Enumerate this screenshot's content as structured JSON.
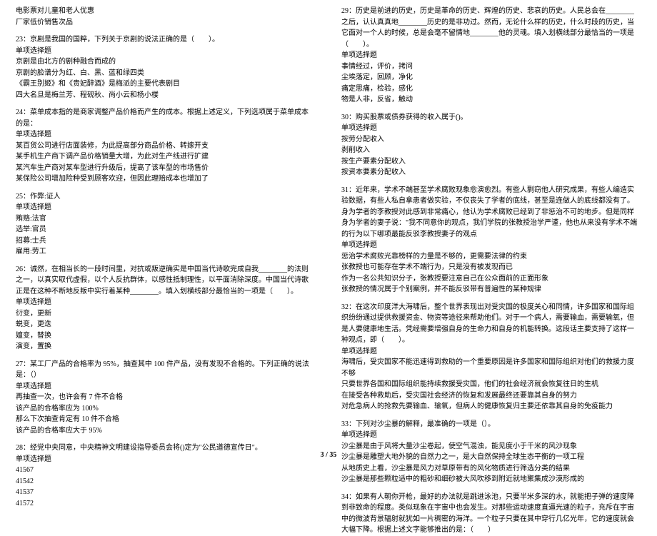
{
  "left": {
    "preamble": [
      "电影票对儿童和老人优惠",
      "厂家低价销售次品"
    ],
    "q23": {
      "stem": "23：京剧是我国的国粹，下列关于京剧的说法正确的是（　　）。",
      "type": "单项选择题",
      "opts": [
        "京剧是由北方的剧种融合而成的",
        "京剧的脸谱分为红、白、黑、蓝和绿四类",
        "《霸王别姬》和《贵妃醉酒》是梅派的主要代表剧目",
        "四大名旦是梅兰芳、程砚秋、尚小云和杨小楼"
      ]
    },
    "q24": {
      "stem": "24：菜单成本指的是商家调整产品价格而产生的成本。根据上述定义，下列选项属于菜单成本的是：",
      "type": "单项选择题",
      "opts": [
        "某百货公司进行店面装修，为此提高部分商品价格、转嫁开支",
        "某手机生产商下调产品价格销量大增，为此对生产线进行扩建",
        "某汽车生产商对某车型进行升级后，提高了该车型的市场售价",
        "某保险公司增加险种受到顾客欢迎，但因此理赔成本也增加了"
      ]
    },
    "q25": {
      "stem": "25：作弊:证人",
      "type": "单项选择题",
      "opts": [
        "贿赂:法官",
        "选举:官员",
        "招募:士兵",
        "雇用:劳工"
      ]
    },
    "q26": {
      "stem": "26：诚然，在相当长的一段时间里，对抗或叛逆确实是中国当代诗歌完成自我________的法则之一，以真实取代虚假，以个人反抗群体，以感性抵制理性，以平面消除深度。中国当代诗歌正是在这种不断地反叛中实行着某种________。填入划横线部分最恰当的一项是（　　）。",
      "type": "单项选择题",
      "opts": [
        "衍变，更新",
        "蜕变，更迭",
        "嬗变，替换",
        "演变，置换"
      ]
    },
    "q27": {
      "stem": "27：某工厂产品的合格率为 95%，抽查其中 100 件产品，没有发现不合格的。下列正确的说法是：（）",
      "type": "单项选择题",
      "opts": [
        "再抽查一次，也许会有 7 件不合格",
        "该产品的合格率应为 100%",
        "那么下次抽查肯定有 10 件不合格",
        "该产品的合格率应大于 95%"
      ]
    },
    "q28": {
      "stem": "28：经党中央同意，中央精神文明建设指导委员会将()定为\"公民道德宣传日\"。",
      "type": "单项选择题",
      "opts": [
        "41567",
        "41542",
        "41537",
        "41572"
      ]
    }
  },
  "right": {
    "q29": {
      "stem": "29：历史是前进的历史，历史是革命的历史、辉煌的历史、悲哀的历史。人民总会在________之后，认认真真地________历史的是非功过。然而，无论什么样的历史，什么时段的历史，当它面对一个人的时候，总是会毫不留情地________他的灵魂。填入划横线部分最恰当的一项是（　　）。",
      "type": "单项选择题",
      "opts": [
        "事情经过，评价，拷问",
        "尘埃落定，回顾，净化",
        "痛定思痛，检验，感化",
        "物是人非，反省，触动"
      ]
    },
    "q30": {
      "stem": "30：购买股票或债券获得的收入属于()。 ",
      "type": "单项选择题",
      "opts": [
        "按劳分配收入",
        "剥削收入",
        "按生产要素分配收入",
        "按资本要素分配收入"
      ]
    },
    "q31": {
      "stem": "31：近年来，学术不端甚至学术腐败现象愈演愈烈。有些人剽窃他人研究成果，有些人编造实验数据，有些人私自拿患者做实验，不仅丧失了学者的底线，甚至是连做人的底线都没有了。身为学者的李教授对此感到非常痛心，他认为学术腐败已经到了非惩治不可的地步。但是同样身为学者的妻子说：\"我不同意你的观点，我们学院的张教授治学严谨，他也从来没有学术不端的行为以下哪项最能反驳李教授妻子的观点",
      "type": "单项选择题",
      "opts": [
        "惩治学术腐败光靠榜样的力量是不够的，更需要法律的约束",
        "张教授也可能存在学术不端行为，只是没有被发现而已",
        "作为一名公共知识分子，张教授要注意自己在公众面前的正面形象",
        "张教授的情况属于个别案例，并不能反驳带有普遍性的某种规律"
      ]
    },
    "q32": {
      "stem": "32：在这次印度洋大海啸后，整个世界表现出对受灾国的极度关心和同情，许多国家和国际组织纷纷通过提供救援资金、物资等途径来帮助他们。对于一个病人，需要输血，需要输氧，但是人要健康地生活。凭经需要增强自身的生命力和自身的机能转换。这段话主要支持了这样一种观点，即（　　）。",
      "type": "单项选择题",
      "opts": [
        "海啸后，受灾国家不能迅速得到救助的一个重要原因是许多国家和国际组织对他们的救援力度不够",
        "只要世界各国和国际组织能持续救援受灾国，他们的社会经济就会恢复往日的生机",
        "在接受各种救助后，受灾国社会经济的恢复和发展最终还要靠其自身的努力",
        "对危急病人的抢救先要输血、输氧，但病人的健康恢复归主要还依靠其自身的免疫能力"
      ]
    },
    "q33": {
      "stem": "33：下列对沙尘暴的解释，最准确的一项是（）。",
      "type": "单项选择题",
      "opts": [
        "沙尘暴是由于风将大量沙尘卷起，使空气混浊，能见度小于千米的风沙现象",
        "沙尘暴是雕塑大地外貌的自然力之一，是大自然保持全球生态平衡的一项工程",
        "从地质史上看，沙尘暴是风力对草原带有的风化物质进行筛选分类的结果",
        "沙尘暴是那些颗粒适中的粗砂和细砂被大风吹移到附近就地聚集成沙漠形成的"
      ]
    },
    "q34": {
      "stem": "34：如果有人朝你开枪，最好的办法就是跳进泳池，只要半米多深的水，就能把子弹的速度降到非致命的程度。类似现象在宇宙中也会发生。对那些运动速度直逼光速的粒子，充斥在宇宙中的微波背景辐射就犹如一片稠密的海洋。一个粒子只要在其中穿行几亿光年，它的速度就会大幅下降。根据上述文字能够推出的是：（　　）"
    }
  },
  "footer": "3 / 35"
}
